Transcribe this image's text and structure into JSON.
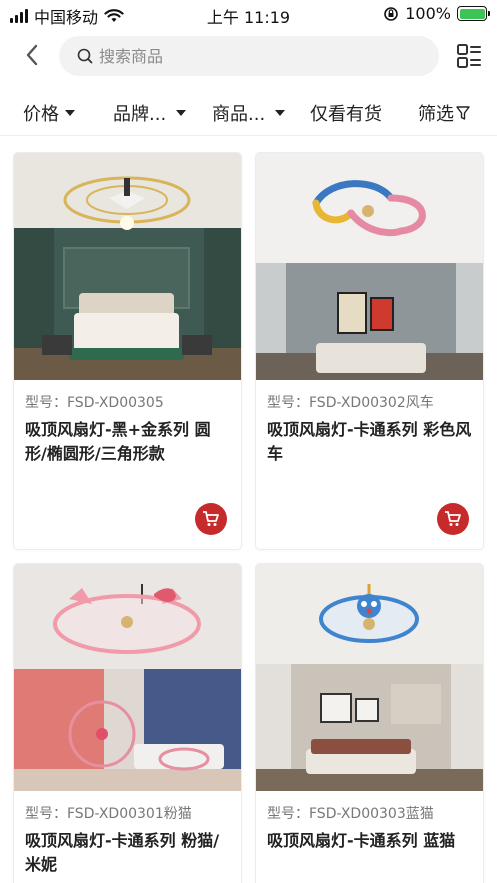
{
  "status_bar": {
    "carrier": "中国移动",
    "time": "上午 11:19",
    "battery": "100%"
  },
  "header": {
    "search_placeholder": "搜索商品",
    "icons": {
      "back": "chevron-left-icon",
      "search": "search-icon",
      "view": "list-view-icon"
    }
  },
  "filters": [
    {
      "label": "价格",
      "has_caret": true
    },
    {
      "label": "品牌...",
      "has_caret": true
    },
    {
      "label": "商品...",
      "has_caret": true
    },
    {
      "label": "仅看有货",
      "has_caret": false
    },
    {
      "label": "筛选",
      "icon": "filter-icon"
    }
  ],
  "products": [
    {
      "model": "型号：FSD-XD00305",
      "name": "吸顶风扇灯-黑+金系列 圆形/椭圆形/三角形款",
      "room": "green bedroom"
    },
    {
      "model": "型号：FSD-XD00302风车",
      "name": "吸顶风扇灯-卡通系列 彩色风车",
      "room": "grey kids room"
    },
    {
      "model": "型号：FSD-XD00301粉猫",
      "name": "吸顶风扇灯-卡通系列 粉猫/米妮",
      "room": "pink kids room"
    },
    {
      "model": "型号：FSD-XD00303蓝猫",
      "name": "吸顶风扇灯-卡通系列 蓝猫",
      "room": "grey bedroom"
    }
  ],
  "colors": {
    "accent": "#c62a2a",
    "search_bg": "#f2f2f2"
  }
}
